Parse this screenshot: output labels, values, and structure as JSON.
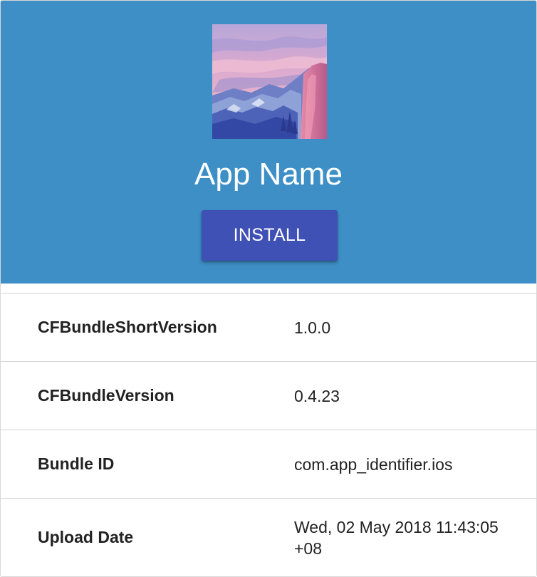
{
  "app": {
    "name": "App Name",
    "install_label": "INSTALL",
    "icon": "mountain-landscape-icon"
  },
  "colors": {
    "hero_background": "#3d8fc6",
    "install_button": "#3f51b5",
    "text": "#222222"
  },
  "info": [
    {
      "key": "CFBundleShortVersion",
      "value": "1.0.0"
    },
    {
      "key": "CFBundleVersion",
      "value": "0.4.23"
    },
    {
      "key": "Bundle ID",
      "value": "com.app_identifier.ios"
    },
    {
      "key": "Upload Date",
      "value": "Wed, 02 May 2018 11:43:05 +08"
    }
  ]
}
